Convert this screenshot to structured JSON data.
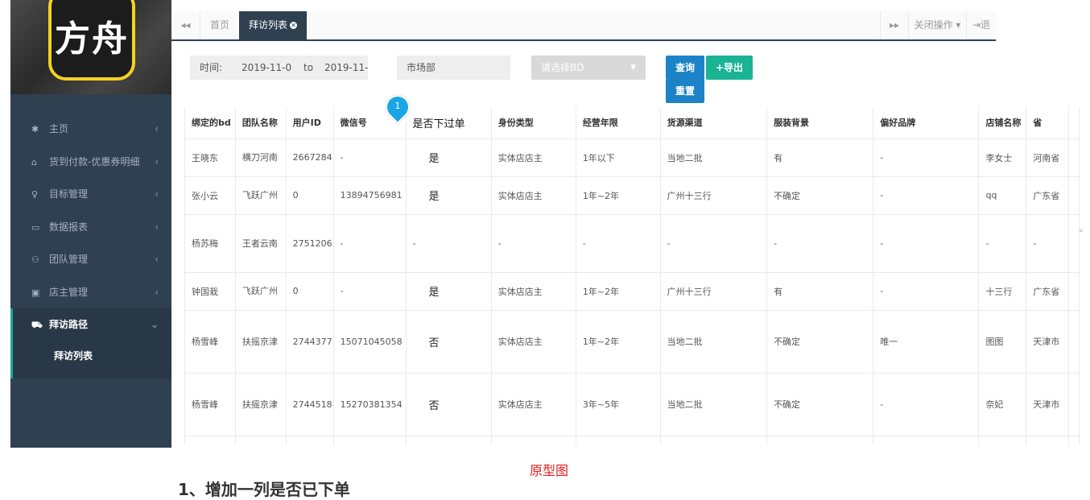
{
  "sidebar": {
    "logo_text": "方舟",
    "items": [
      {
        "icon": "home-icon",
        "glyph": "✱",
        "label": "主页"
      },
      {
        "icon": "bank-icon",
        "glyph": "⌂",
        "label": "货到付款-优惠券明细"
      },
      {
        "icon": "target-icon",
        "glyph": "♀",
        "label": "目标管理"
      },
      {
        "icon": "report-icon",
        "glyph": "▭",
        "label": "数据报表"
      },
      {
        "icon": "team-icon",
        "glyph": "⚇",
        "label": "团队管理"
      },
      {
        "icon": "shop-icon",
        "glyph": "▣",
        "label": "店主管理"
      }
    ],
    "active_item": {
      "icon": "car-icon",
      "glyph": "⛟",
      "label": "拜访路径",
      "arrow": "⌄"
    },
    "sub_item": {
      "label": "拜访列表"
    },
    "arrow_glyph": "‹"
  },
  "tabs": {
    "prev_glyph": "◂◂",
    "home": "首页",
    "active": "拜访列表",
    "next_glyph": "▸▸",
    "close_ops": "关闭操作",
    "logout": "退"
  },
  "filters": {
    "time_label": "时间:",
    "date_from": "2019-11-0",
    "to_label": "to",
    "date_to": "2019-11-",
    "department": "市场部",
    "bd_placeholder": "请选择BD",
    "query_button": "查询",
    "export_button": "+导出",
    "reset_button": "重置"
  },
  "table": {
    "columns": [
      "绑定的bd",
      "团队名称",
      "用户ID",
      "微信号",
      "是否下过单",
      "身份类型",
      "经营年限",
      "货源渠道",
      "服装背景",
      "偏好品牌",
      "店铺名称",
      "省",
      " "
    ],
    "rows": [
      [
        "王晓东",
        "横刀河南",
        "2667284",
        "-",
        "是",
        "实体店店主",
        "1年以下",
        "当地二批",
        "有",
        "-",
        "李女士",
        "河南省",
        ""
      ],
      [
        "张小云",
        "飞跃广州",
        "0",
        "13894756981",
        "是",
        "实体店店主",
        "1年~2年",
        "广州十三行",
        "不确定",
        "-",
        "qq",
        "广东省",
        ""
      ],
      [
        "杨苏梅",
        "王者云南",
        "2751206",
        "-",
        "-",
        "-",
        "-",
        "-",
        "-",
        "-",
        "-",
        "-",
        ""
      ],
      [
        "钟国栽",
        "飞跃广州",
        "0",
        "-",
        "是",
        "实体店店主",
        "1年~2年",
        "广州十三行",
        "有",
        "-",
        "十三行",
        "广东省",
        ""
      ],
      [
        "杨雪峰",
        "扶摇京津",
        "2744377",
        "15071045058",
        "否",
        "实体店店主",
        "1年~2年",
        "当地二批",
        "不确定",
        "唯一",
        "图图",
        "天津市",
        ""
      ],
      [
        "杨雪峰",
        "扶摇京津",
        "2744518",
        "15270381354",
        "否",
        "实体店店主",
        "3年~5年",
        "当地二批",
        "不确定",
        "-",
        "奈妃",
        "天津市",
        ""
      ]
    ]
  },
  "annotation": {
    "marker": "1"
  },
  "caption": "原型图",
  "note": "1、增加一列是否已下单"
}
